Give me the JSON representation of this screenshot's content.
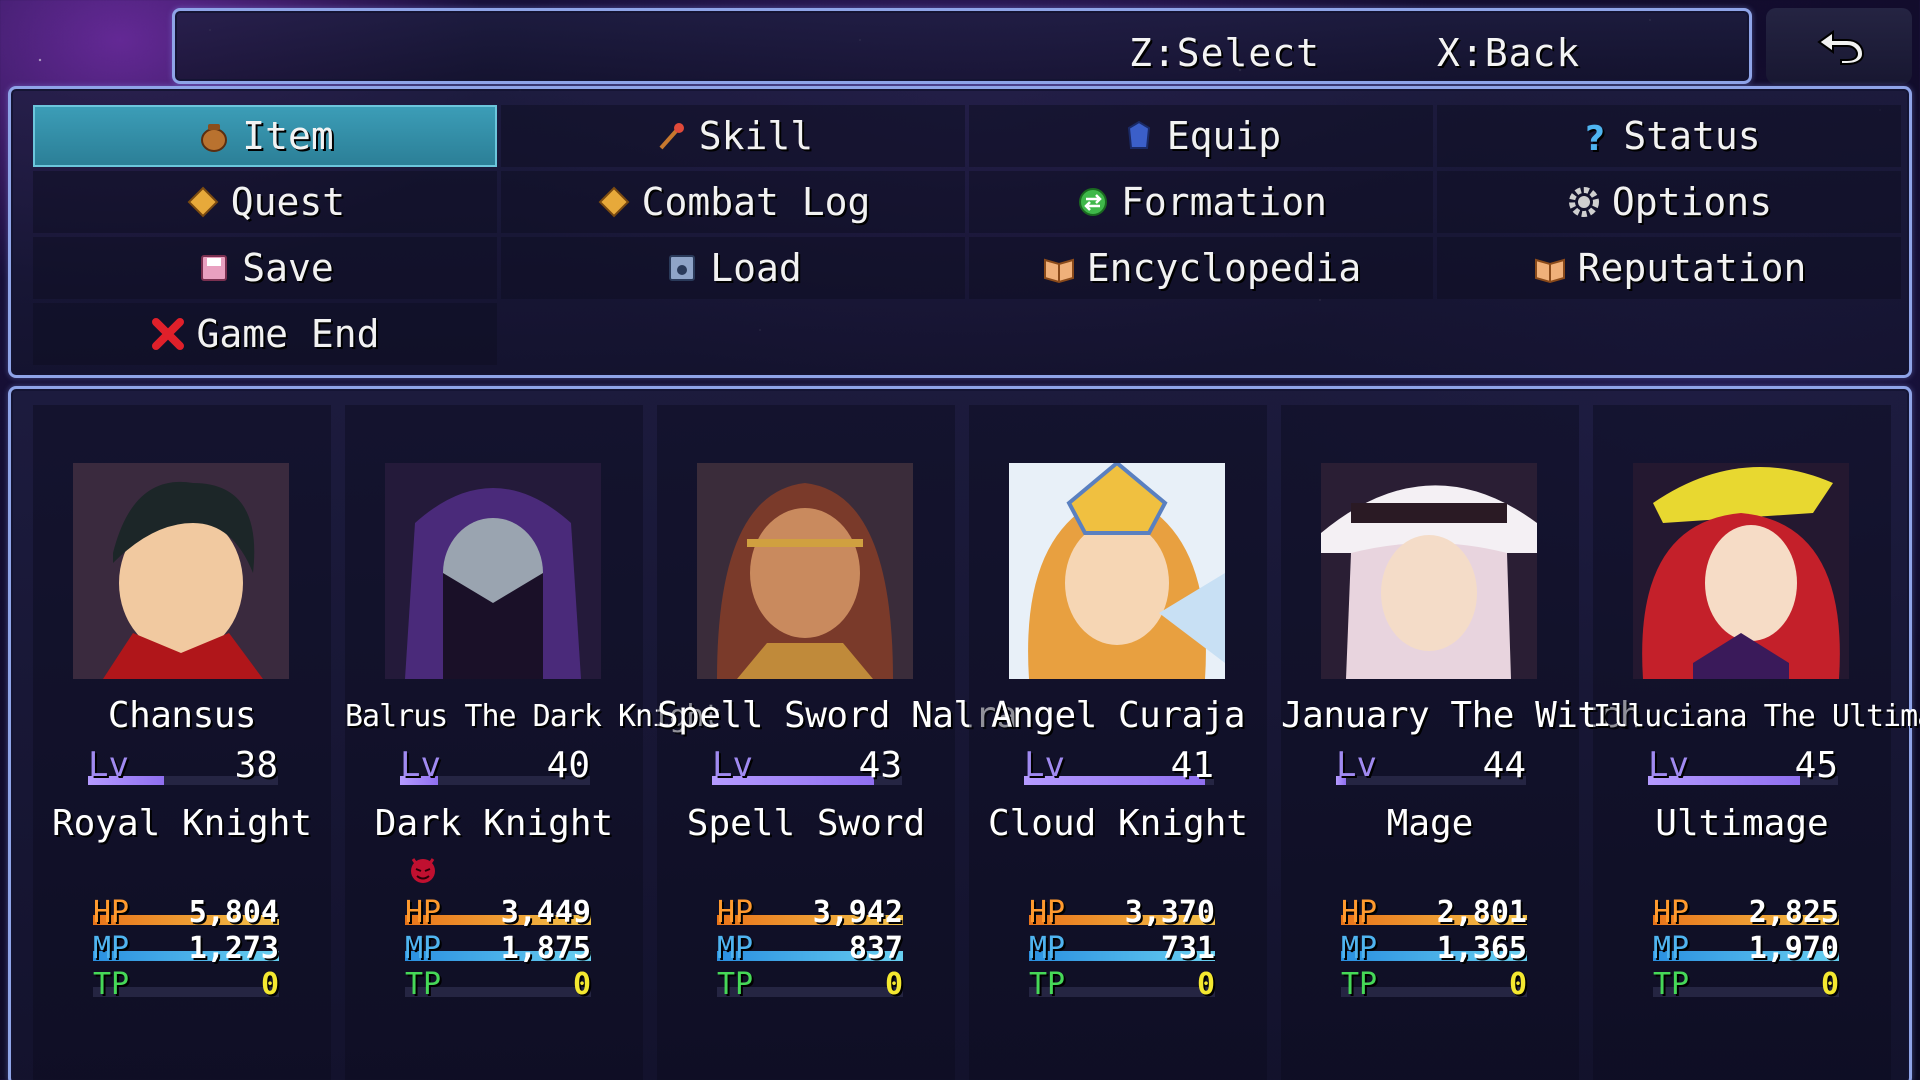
{
  "help": {
    "select": "Z:Select",
    "back": "X:Back"
  },
  "commands": [
    {
      "label": "Item",
      "icon": "pouch-icon"
    },
    {
      "label": "Skill",
      "icon": "wand-icon"
    },
    {
      "label": "Equip",
      "icon": "armor-icon"
    },
    {
      "label": "Status",
      "icon": "question-icon"
    },
    {
      "label": "Quest",
      "icon": "diamond-icon"
    },
    {
      "label": "Combat Log",
      "icon": "diamond-icon"
    },
    {
      "label": "Formation",
      "icon": "swap-icon"
    },
    {
      "label": "Options",
      "icon": "gear-icon"
    },
    {
      "label": "Save",
      "icon": "save-icon"
    },
    {
      "label": "Load",
      "icon": "disk-icon"
    },
    {
      "label": "Encyclopedia",
      "icon": "book-icon"
    },
    {
      "label": "Reputation",
      "icon": "book-icon"
    },
    {
      "label": "Game End",
      "icon": "red-x-icon"
    }
  ],
  "selected_command": "Item",
  "party": [
    {
      "name": "Chansus",
      "lv_label": "Lv",
      "level": "38",
      "level_progress": 0.4,
      "class": "Royal Knight",
      "hp_label": "HP",
      "hp": "5,804",
      "mp_label": "MP",
      "mp": "1,273",
      "tp_label": "TP",
      "tp": "0",
      "hp_ratio": 1,
      "mp_ratio": 1,
      "tp_ratio": 0,
      "state_icon": ""
    },
    {
      "name": "Balrus The Dark Knight",
      "lv_label": "Lv",
      "level": "40",
      "level_progress": 0.2,
      "class": "Dark Knight",
      "hp_label": "HP",
      "hp": "3,449",
      "mp_label": "MP",
      "mp": "1,875",
      "tp_label": "TP",
      "tp": "0",
      "hp_ratio": 1,
      "mp_ratio": 1,
      "tp_ratio": 0,
      "state_icon": "devil-face-icon"
    },
    {
      "name": "Spell Sword Nalra",
      "lv_label": "Lv",
      "level": "43",
      "level_progress": 0.85,
      "class": "Spell Sword",
      "hp_label": "HP",
      "hp": "3,942",
      "mp_label": "MP",
      "mp": "837",
      "tp_label": "TP",
      "tp": "0",
      "hp_ratio": 1,
      "mp_ratio": 1,
      "tp_ratio": 0,
      "state_icon": ""
    },
    {
      "name": "Angel Curaja",
      "lv_label": "Lv",
      "level": "41",
      "level_progress": 0.95,
      "class": "Cloud Knight",
      "hp_label": "HP",
      "hp": "3,370",
      "mp_label": "MP",
      "mp": "731",
      "tp_label": "TP",
      "tp": "0",
      "hp_ratio": 1,
      "mp_ratio": 1,
      "tp_ratio": 0,
      "state_icon": ""
    },
    {
      "name": "January The Witch",
      "lv_label": "Lv",
      "level": "44",
      "level_progress": 0.05,
      "class": "Mage",
      "hp_label": "HP",
      "hp": "2,801",
      "mp_label": "MP",
      "mp": "1,365",
      "tp_label": "TP",
      "tp": "0",
      "hp_ratio": 1,
      "mp_ratio": 1,
      "tp_ratio": 0,
      "state_icon": ""
    },
    {
      "name": "Illuciana The Ultimage",
      "lv_label": "Lv",
      "level": "45",
      "level_progress": 0.8,
      "class": "Ultimage",
      "hp_label": "HP",
      "hp": "2,825",
      "mp_label": "MP",
      "mp": "1,970",
      "tp_label": "TP",
      "tp": "0",
      "hp_ratio": 1,
      "mp_ratio": 1,
      "tp_ratio": 0,
      "state_icon": ""
    }
  ]
}
